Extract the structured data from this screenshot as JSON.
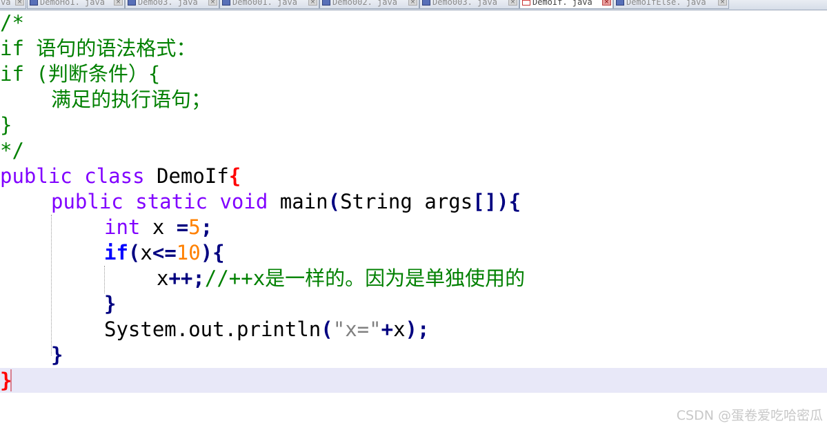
{
  "tabs": [
    {
      "label": "va",
      "active": false
    },
    {
      "label": "DemoHo1. java",
      "active": false
    },
    {
      "label": "Demo03. java",
      "active": false
    },
    {
      "label": "Demo001. java",
      "active": false
    },
    {
      "label": "Demo002. java",
      "active": false
    },
    {
      "label": "Demo003. java",
      "active": false
    },
    {
      "label": "DemoIf. java",
      "active": true
    },
    {
      "label": "DemoIfElse. java",
      "active": false
    }
  ],
  "code": {
    "l1": "/*",
    "l2_a": "if ",
    "l2_b": "语句的语法格式：",
    "l3_a": "if (",
    "l3_b": "判断条件）",
    "l3_c": "{",
    "l4": "满足的执行语句；",
    "l5": "}",
    "l6": "*/",
    "l7_kw1": "public",
    "l7_kw2": "class",
    "l7_name": "DemoIf",
    "l7_brace": "{",
    "l8_kw1": "public",
    "l8_kw2": "static",
    "l8_kw3": "void",
    "l8_name": "main",
    "l8_p1": "(",
    "l8_type": "String",
    "l8_arg": "args",
    "l8_br": "[])",
    "l8_brace": "{",
    "l9_type": "int",
    "l9_var": "x",
    "l9_op": "=",
    "l9_num": "5",
    "l9_semi": ";",
    "l10_kw": "if",
    "l10_p": "(",
    "l10_var": "x",
    "l10_op": "<=",
    "l10_num": "10",
    "l10_close": "){",
    "l11_var": "x",
    "l11_op": "++;",
    "l11_comment_a": "//++x",
    "l11_comment_b": "是一样的。因为是单独使用的",
    "l12": "}",
    "l13_a": "System.out.println",
    "l13_p": "(",
    "l13_str": "\"x=\"",
    "l13_plus": "+",
    "l13_var": "x",
    "l13_end": ");",
    "l14": "}",
    "l15": "}"
  },
  "watermark": "CSDN @蛋卷爱吃哈密瓜",
  "colors": {
    "comment": "#008000",
    "keyword": "#8000ff",
    "control": "#0000ff",
    "number": "#ff8000",
    "string": "#808080",
    "operator": "#000080",
    "class_brace": "#ff0000",
    "current_line": "#e8e8f8"
  }
}
